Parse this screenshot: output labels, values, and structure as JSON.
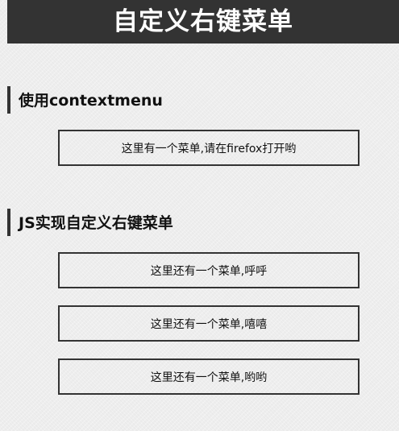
{
  "header": {
    "title": "自定义右键菜单"
  },
  "sections": [
    {
      "title": "使用contextmenu",
      "boxes": [
        {
          "label": "这里有一个菜单,请在firefox打开哟"
        }
      ]
    },
    {
      "title": "JS实现自定义右键菜单",
      "boxes": [
        {
          "label": "这里还有一个菜单,呼呼"
        },
        {
          "label": "这里还有一个菜单,嘻嘻"
        },
        {
          "label": "这里还有一个菜单,哟哟"
        }
      ]
    }
  ],
  "colors": {
    "header_background": "#333333",
    "header_text": "#ffffff",
    "page_background": "#eeeeee",
    "border": "#333333"
  }
}
